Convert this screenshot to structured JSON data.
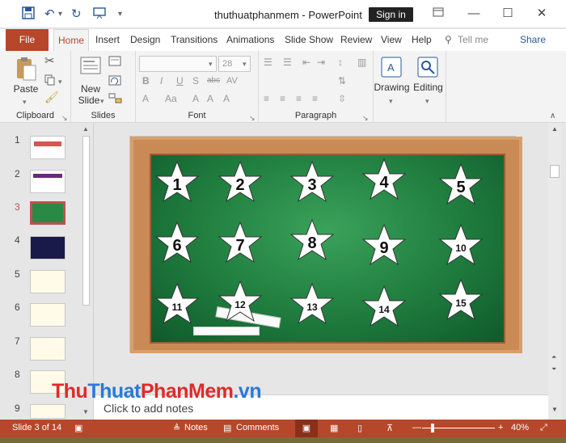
{
  "titlebar": {
    "title": "thuthuatphanmem  -  PowerPoint",
    "signin": "Sign in",
    "icons": [
      "save-icon",
      "undo-icon",
      "redo-icon",
      "present-icon",
      "customize-icon"
    ]
  },
  "tabs": [
    "File",
    "Home",
    "Insert",
    "Design",
    "Transitions",
    "Animations",
    "Slide Show",
    "Review",
    "View",
    "Help",
    "Tell me",
    "Share"
  ],
  "ribbon": {
    "paste": "Paste",
    "new_slide": "New",
    "new_slide2": "Slide",
    "font_size": "28",
    "drawing": "Drawing",
    "editing": "Editing",
    "groups": {
      "clipboard": "Clipboard",
      "slides": "Slides",
      "font": "Font",
      "paragraph": "Paragraph"
    }
  },
  "slides": [
    {
      "num": "1"
    },
    {
      "num": "2"
    },
    {
      "num": "3"
    },
    {
      "num": "4"
    },
    {
      "num": "5"
    },
    {
      "num": "6"
    },
    {
      "num": "7"
    },
    {
      "num": "8"
    },
    {
      "num": "9"
    }
  ],
  "stars": [
    "1",
    "2",
    "3",
    "4",
    "5",
    "6",
    "7",
    "8",
    "9",
    "10",
    "11",
    "12",
    "13",
    "14",
    "15"
  ],
  "notes": "Click to add notes",
  "watermark": {
    "a": "Thu",
    "b": "Thuat",
    "c": "PhanMem",
    ".d": ".vn"
  },
  "status": {
    "slide": "Slide 3 of 14",
    "notes": "Notes",
    "comments": "Comments",
    "zoom": "40%"
  }
}
